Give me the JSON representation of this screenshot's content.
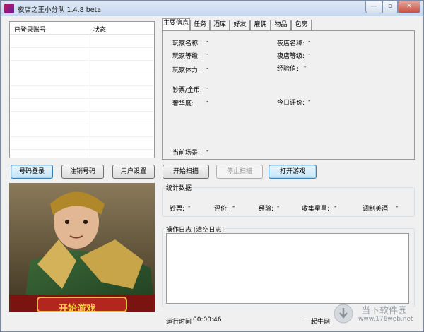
{
  "window": {
    "title": "夜店之王小分队 1.4.8 beta",
    "controls": {
      "minimize": "—",
      "maximize": "▫",
      "close": "✕"
    }
  },
  "account_list": {
    "columns": [
      "已登录账号",
      "状态"
    ]
  },
  "tabs": [
    "主要信息",
    "任务",
    "酒库",
    "好友",
    "雇佣",
    "物品",
    "包房"
  ],
  "info": {
    "player_name": {
      "label": "玩家名称:",
      "value": "-"
    },
    "club_name": {
      "label": "夜店名称:",
      "value": "-"
    },
    "player_level": {
      "label": "玩家等级:",
      "value": "-"
    },
    "club_level": {
      "label": "夜店等级:",
      "value": "-"
    },
    "player_stamina": {
      "label": "玩家体力:",
      "value": "-"
    },
    "experience": {
      "label": "经验值:",
      "value": "-"
    },
    "money_gold": {
      "label": "钞票/金币:",
      "value": "-"
    },
    "luxury": {
      "label": "奢华度:",
      "value": "-"
    },
    "today_rating": {
      "label": "今日评价:",
      "value": "-"
    },
    "current_scene": {
      "label": "当前场景:",
      "value": "-"
    }
  },
  "buttons": {
    "login": "号码登录",
    "logout": "注销号码",
    "user_settings": "用户设置",
    "start_scan": "开始扫描",
    "stop_scan": "停止扫描",
    "open_game": "打开游戏"
  },
  "stats": {
    "title": "统计数据",
    "items": [
      {
        "label": "钞票:",
        "value": "-"
      },
      {
        "label": "评价:",
        "value": "-"
      },
      {
        "label": "经验:",
        "value": "-"
      },
      {
        "label": "收集星星:",
        "value": "-"
      },
      {
        "label": "调制美酒:",
        "value": "-"
      }
    ]
  },
  "log": {
    "title": "操作日志 [",
    "clear_link": "清空日志",
    "title_end": "]"
  },
  "ad_banner": {
    "text": "开始游戏"
  },
  "status": {
    "runtime_label": "运行时间",
    "runtime_value": "00:00:46",
    "link": "一起牛网"
  },
  "watermark": {
    "line1": "当下软件园",
    "line2": "www.176web.net"
  },
  "colors": {
    "titlebar": "#c7d8ee",
    "close": "#c8503e",
    "focus_border": "#3c7fb1",
    "banner_red": "#b3261e"
  }
}
